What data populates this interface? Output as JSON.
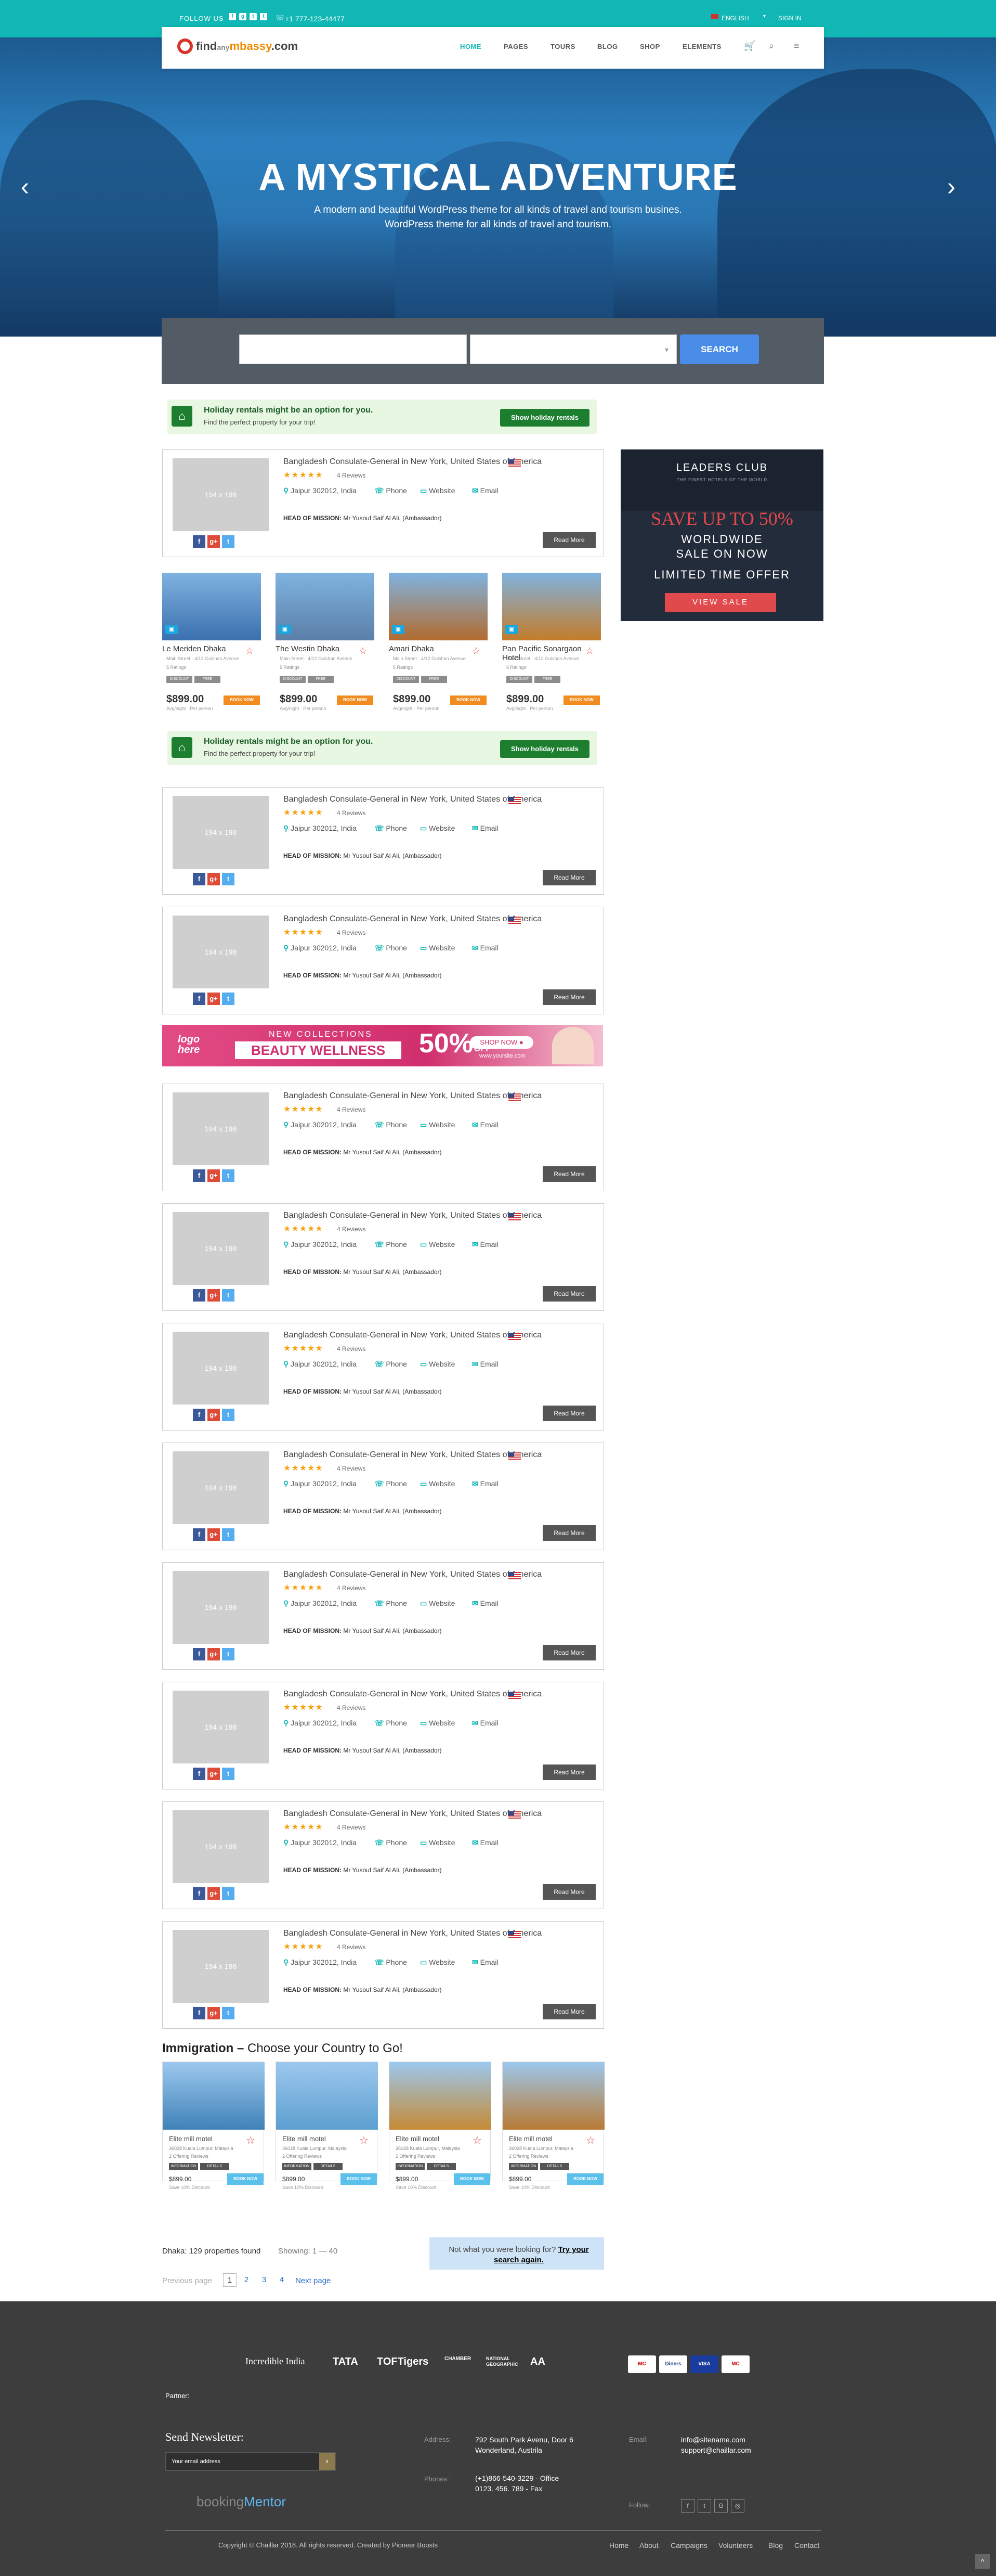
{
  "topbar": {
    "follow": "FOLLOW US",
    "social": [
      "f",
      "g",
      "t",
      "t"
    ],
    "phone": "+1 777-123-44477",
    "language": "ENGLISH",
    "signin": "SIGN IN"
  },
  "header": {
    "logo_a": "find",
    "logo_b": "any",
    "logo_c": "mbassy",
    "logo_d": ".com",
    "nav": [
      "HOME",
      "PAGES",
      "TOURS",
      "BLOG",
      "SHOP",
      "ELEMENTS"
    ]
  },
  "hero": {
    "title": "A MYSTICAL ADVENTURE",
    "subtitle_1": "A modern and beautiful WordPress theme for all kinds of travel and tourism busines.",
    "subtitle_2": "WordPress theme for all kinds of travel and tourism."
  },
  "search": {
    "button": "SEARCH"
  },
  "holiday": {
    "title": "Holiday rentals might be an option for you.",
    "subtitle": "Find the perfect property for your trip!",
    "button": "Show holiday rentals"
  },
  "listing": {
    "placeholder": "194 x 198",
    "title": "Bangladesh Consulate-General in New York, United States of America",
    "stars": "★★★★★",
    "reviews": "4 Reviews",
    "location": "Jaipur 302012, India",
    "phone": "Phone",
    "website": "Website",
    "email": "Email",
    "head_label": "HEAD OF MISSION:",
    "head_value": "Mr Yusouf Saif Al Ali, (Ambassador)",
    "read_more": "Read More"
  },
  "hotels": [
    {
      "name": "Le Meriden Dhaka",
      "price": "$899.00",
      "color": "#3b6fae"
    },
    {
      "name": "The Westin Dhaka",
      "price": "$899.00",
      "color": "#5a7fa8"
    },
    {
      "name": "Amari Dhaka",
      "price": "$899.00",
      "color": "#b36b2e"
    },
    {
      "name": "Pan Pacific Sonargaon Hotel",
      "price": "$899.00",
      "color": "#c47c2a"
    }
  ],
  "hotel_common": {
    "addr": "Main Street · 4/12 Gulshan Avenue",
    "rating": "5 Ratings",
    "tags": [
      "DISCOUNT",
      "FREE"
    ],
    "per_night": "Avg/night · Per person",
    "book": "BOOK NOW"
  },
  "ad_side": {
    "brand": "LEADERS CLUB",
    "brand_sub": "THE FINEST HOTELS OF THE WORLD",
    "save": "SAVE UP TO 50%",
    "line1": "WORLDWIDE",
    "line2": "SALE ON NOW",
    "line3": "LIMITED TIME OFFER",
    "button": "VIEW SALE"
  },
  "banner": {
    "logo": "logo here",
    "kicker": "NEW COLLECTIONS",
    "title": "BEAUTY WELLNESS",
    "percent": "50%",
    "off": "OFF",
    "shop": "SHOP NOW ●",
    "url": "www.yoursite.com"
  },
  "immigration": {
    "title": "Immigration",
    "subtitle": "Choose your Country to Go!",
    "card_name": "Elite mill motel",
    "card_addr": "36028 Kuala Lumpur, Malaysia",
    "card_offer": "2 Offering Reviews",
    "tag1": "INFORMATION",
    "tag2": "DETAILS",
    "price": "$899.00",
    "save": "Save 10% Discount",
    "book": "BOOK NOW",
    "colors": [
      "#3f82b8",
      "#5c9fd0",
      "#c58a35",
      "#b97a34"
    ]
  },
  "results": {
    "count": "Dhaka: 129 properties found",
    "showing": "Showing: 1 — 40",
    "notfound": "Not what you were looking for?",
    "tryagain": "Try your search again."
  },
  "pagination": {
    "prev": "Previous page",
    "pages": [
      "1",
      "2",
      "3",
      "4"
    ],
    "next": "Next page"
  },
  "footer": {
    "partners": [
      "Incredible India",
      "TATA",
      "TOFTigers",
      "CHAMBER",
      "NATIONAL GEOGRAPHIC",
      "AA"
    ],
    "payments": [
      "MC",
      "Diners",
      "VISA",
      "MC"
    ],
    "partner_label": "Partner:",
    "newsletter": "Send Newsletter:",
    "email_placeholder": "Your email address",
    "address_label": "Address:",
    "address": [
      "792 South Park Avenu, Door 6",
      "Wonderland, Austrila"
    ],
    "phones_label": "Phones:",
    "phones": [
      "(+1)866-540-3229 - Office",
      "0123. 456. 789 - Fax"
    ],
    "email_label": "Email:",
    "emails": [
      "info@sitename.com",
      "support@chaillar.com"
    ],
    "follow_label": "Follow:",
    "brand_a": "booking",
    "brand_b": "Mentor",
    "copyright": "Copyright © Chaillar 2018. All rights reserved. Created by Pioneer Boosts",
    "links": [
      "Home",
      "About",
      "Campaigns",
      "Volunteers",
      "Blog",
      "Contact"
    ]
  }
}
